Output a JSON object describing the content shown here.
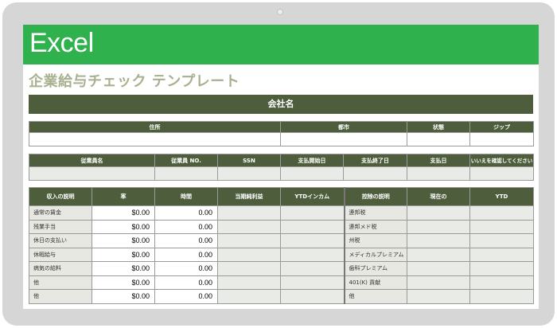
{
  "app": {
    "brand": "Excel"
  },
  "document": {
    "title": "企業給与チェック テンプレート"
  },
  "company": {
    "label": "会社名"
  },
  "address_table": {
    "headers": [
      "住所",
      "都市",
      "状態",
      "ジップ"
    ]
  },
  "employee_table": {
    "headers": [
      "従業員名",
      "従業員 NO.",
      "SSN",
      "支払開始日",
      "支払終了日",
      "支払日",
      "いいえを確認してください"
    ]
  },
  "earnings_table": {
    "headers": [
      "収入の説明",
      "率",
      "時間",
      "当期純利益",
      "YTDインカム"
    ],
    "rows": [
      {
        "desc": "通常の賃金",
        "rate": "$0.00",
        "hours": "0.00"
      },
      {
        "desc": "残業手当",
        "rate": "$0.00",
        "hours": "0.00"
      },
      {
        "desc": "休日の支払い",
        "rate": "$0.00",
        "hours": "0.00"
      },
      {
        "desc": "休暇給与",
        "rate": "$0.00",
        "hours": "0.00"
      },
      {
        "desc": "病気の給料",
        "rate": "$0.00",
        "hours": "0.00"
      },
      {
        "desc": "他",
        "rate": "$0.00",
        "hours": "0.00"
      },
      {
        "desc": "他",
        "rate": "$0.00",
        "hours": "0.00"
      }
    ]
  },
  "deductions_table": {
    "headers": [
      "控除の説明",
      "現在の",
      "YTD"
    ],
    "rows": [
      "連邦税",
      "連邦メド税",
      "州税",
      "メディカルプレミアム",
      "歯科プレミアム",
      "401(K) 貢献",
      "他"
    ]
  }
}
